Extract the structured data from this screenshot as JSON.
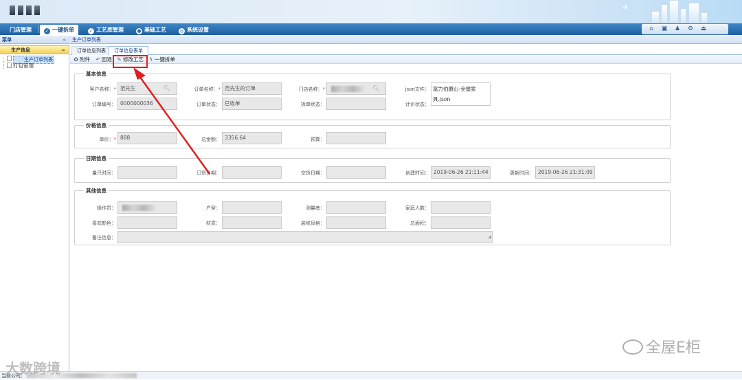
{
  "nav": {
    "tabs": [
      {
        "label": "门店管理",
        "active": false
      },
      {
        "label": "一键拆单",
        "active": true
      },
      {
        "label": "工艺库管理",
        "active": false
      },
      {
        "label": "基础工艺",
        "active": false
      },
      {
        "label": "系统设置",
        "active": false
      }
    ],
    "tool_icons": [
      "home-icon",
      "calendar-icon",
      "user-icon",
      "gear-icon",
      "exit-icon"
    ]
  },
  "sidebar": {
    "header": "菜单",
    "collapse_glyph": "«",
    "group": "生产信息",
    "group_toggle_glyph": "≈",
    "items": [
      {
        "label": "生产订单列表",
        "active": true
      },
      {
        "label": "打包管理",
        "active": false
      }
    ]
  },
  "main": {
    "breadcrumb": "生产订单列表",
    "subtabs": [
      {
        "label": "订单信息列表",
        "active": false
      },
      {
        "label": "订单信息表单",
        "active": true
      }
    ],
    "actions": [
      {
        "label": "附件",
        "icon": "attachment-icon",
        "glyph": "✪"
      },
      {
        "label": "回退",
        "icon": "back-icon",
        "glyph": "↶"
      },
      {
        "label": "修改工艺",
        "icon": "pencil-icon",
        "glyph": "✎"
      },
      {
        "label": "一键拆单",
        "icon": "lightning-icon",
        "glyph": "ϟ"
      }
    ]
  },
  "form": {
    "basic": {
      "title": "基本信息",
      "customer_name_label": "客户名称：",
      "customer_name": "范先生",
      "order_name_label": "订单名称：",
      "order_name": "范先生的订单",
      "store_name_label": "门店名称：",
      "store_name": "",
      "json_file_label": "json文件：",
      "json_file": "富力伯爵山-全屋家具.json",
      "order_no_label": "订单编号：",
      "order_no": "0000000036",
      "order_status_label": "订单状态：",
      "order_status": "已收单",
      "split_status_label": "拆单状态：",
      "split_status": "",
      "pricing_status_label": "计价状态：",
      "pricing_status": ""
    },
    "price": {
      "title": "价格信息",
      "unit_price_label": "单价：",
      "unit_price": "888",
      "total_label": "总金额：",
      "total": "3356.64",
      "budget_label": "预算：",
      "budget": ""
    },
    "dates": {
      "title": "日期信息",
      "measure_time_label": "量尺时间：",
      "measure_time": "",
      "order_date_label": "订货日期：",
      "order_date": "",
      "delivery_date_label": "交货日期：",
      "delivery_date": "",
      "created_label": "创建时间：",
      "created": "2019-06-26 21:11:44",
      "updated_label": "更新时间：",
      "updated": "2019-06-26 21:31:09"
    },
    "other": {
      "title": "其他信息",
      "operator_label": "操作员：",
      "operator": "",
      "house_type_label": "户型：",
      "house_type": "",
      "measurer_label": "测量者：",
      "measurer": "",
      "family_size_label": "家庭人数：",
      "family_size": "",
      "color_label": "喜欢颜色：",
      "color": "",
      "material_label": "材质：",
      "material": "",
      "style_label": "装修风格：",
      "style": "",
      "area_label": "总面积：",
      "area": "",
      "remark_label": "备注信息：",
      "remark": ""
    },
    "required_mark": "*"
  },
  "footer": {
    "company_label": "当前公司："
  },
  "watermarks": {
    "left": "大数跨境",
    "right": "全屋E柜"
  },
  "colors": {
    "nav_bg": "#2a6db0",
    "highlight": "#e11e1e",
    "group_bg": "#f4d25a"
  }
}
